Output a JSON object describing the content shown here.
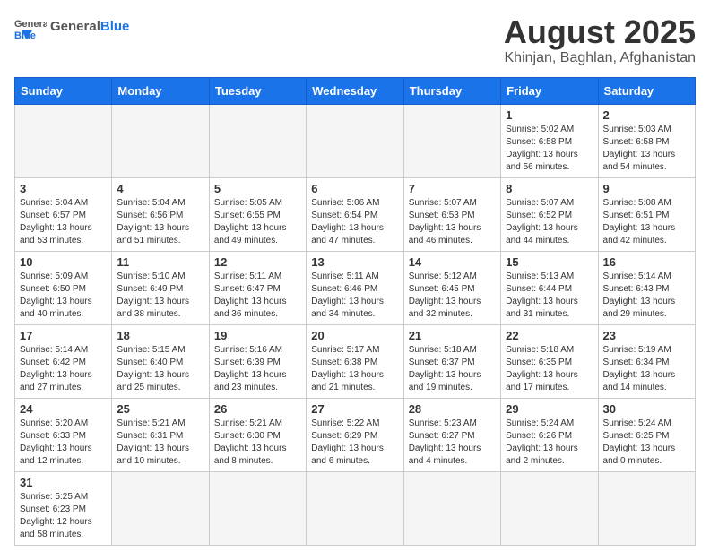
{
  "header": {
    "logo_general": "General",
    "logo_blue": "Blue",
    "title": "August 2025",
    "subtitle": "Khinjan, Baghlan, Afghanistan"
  },
  "weekdays": [
    "Sunday",
    "Monday",
    "Tuesday",
    "Wednesday",
    "Thursday",
    "Friday",
    "Saturday"
  ],
  "weeks": [
    [
      {
        "day": "",
        "info": ""
      },
      {
        "day": "",
        "info": ""
      },
      {
        "day": "",
        "info": ""
      },
      {
        "day": "",
        "info": ""
      },
      {
        "day": "",
        "info": ""
      },
      {
        "day": "1",
        "info": "Sunrise: 5:02 AM\nSunset: 6:58 PM\nDaylight: 13 hours and 56 minutes."
      },
      {
        "day": "2",
        "info": "Sunrise: 5:03 AM\nSunset: 6:58 PM\nDaylight: 13 hours and 54 minutes."
      }
    ],
    [
      {
        "day": "3",
        "info": "Sunrise: 5:04 AM\nSunset: 6:57 PM\nDaylight: 13 hours and 53 minutes."
      },
      {
        "day": "4",
        "info": "Sunrise: 5:04 AM\nSunset: 6:56 PM\nDaylight: 13 hours and 51 minutes."
      },
      {
        "day": "5",
        "info": "Sunrise: 5:05 AM\nSunset: 6:55 PM\nDaylight: 13 hours and 49 minutes."
      },
      {
        "day": "6",
        "info": "Sunrise: 5:06 AM\nSunset: 6:54 PM\nDaylight: 13 hours and 47 minutes."
      },
      {
        "day": "7",
        "info": "Sunrise: 5:07 AM\nSunset: 6:53 PM\nDaylight: 13 hours and 46 minutes."
      },
      {
        "day": "8",
        "info": "Sunrise: 5:07 AM\nSunset: 6:52 PM\nDaylight: 13 hours and 44 minutes."
      },
      {
        "day": "9",
        "info": "Sunrise: 5:08 AM\nSunset: 6:51 PM\nDaylight: 13 hours and 42 minutes."
      }
    ],
    [
      {
        "day": "10",
        "info": "Sunrise: 5:09 AM\nSunset: 6:50 PM\nDaylight: 13 hours and 40 minutes."
      },
      {
        "day": "11",
        "info": "Sunrise: 5:10 AM\nSunset: 6:49 PM\nDaylight: 13 hours and 38 minutes."
      },
      {
        "day": "12",
        "info": "Sunrise: 5:11 AM\nSunset: 6:47 PM\nDaylight: 13 hours and 36 minutes."
      },
      {
        "day": "13",
        "info": "Sunrise: 5:11 AM\nSunset: 6:46 PM\nDaylight: 13 hours and 34 minutes."
      },
      {
        "day": "14",
        "info": "Sunrise: 5:12 AM\nSunset: 6:45 PM\nDaylight: 13 hours and 32 minutes."
      },
      {
        "day": "15",
        "info": "Sunrise: 5:13 AM\nSunset: 6:44 PM\nDaylight: 13 hours and 31 minutes."
      },
      {
        "day": "16",
        "info": "Sunrise: 5:14 AM\nSunset: 6:43 PM\nDaylight: 13 hours and 29 minutes."
      }
    ],
    [
      {
        "day": "17",
        "info": "Sunrise: 5:14 AM\nSunset: 6:42 PM\nDaylight: 13 hours and 27 minutes."
      },
      {
        "day": "18",
        "info": "Sunrise: 5:15 AM\nSunset: 6:40 PM\nDaylight: 13 hours and 25 minutes."
      },
      {
        "day": "19",
        "info": "Sunrise: 5:16 AM\nSunset: 6:39 PM\nDaylight: 13 hours and 23 minutes."
      },
      {
        "day": "20",
        "info": "Sunrise: 5:17 AM\nSunset: 6:38 PM\nDaylight: 13 hours and 21 minutes."
      },
      {
        "day": "21",
        "info": "Sunrise: 5:18 AM\nSunset: 6:37 PM\nDaylight: 13 hours and 19 minutes."
      },
      {
        "day": "22",
        "info": "Sunrise: 5:18 AM\nSunset: 6:35 PM\nDaylight: 13 hours and 17 minutes."
      },
      {
        "day": "23",
        "info": "Sunrise: 5:19 AM\nSunset: 6:34 PM\nDaylight: 13 hours and 14 minutes."
      }
    ],
    [
      {
        "day": "24",
        "info": "Sunrise: 5:20 AM\nSunset: 6:33 PM\nDaylight: 13 hours and 12 minutes."
      },
      {
        "day": "25",
        "info": "Sunrise: 5:21 AM\nSunset: 6:31 PM\nDaylight: 13 hours and 10 minutes."
      },
      {
        "day": "26",
        "info": "Sunrise: 5:21 AM\nSunset: 6:30 PM\nDaylight: 13 hours and 8 minutes."
      },
      {
        "day": "27",
        "info": "Sunrise: 5:22 AM\nSunset: 6:29 PM\nDaylight: 13 hours and 6 minutes."
      },
      {
        "day": "28",
        "info": "Sunrise: 5:23 AM\nSunset: 6:27 PM\nDaylight: 13 hours and 4 minutes."
      },
      {
        "day": "29",
        "info": "Sunrise: 5:24 AM\nSunset: 6:26 PM\nDaylight: 13 hours and 2 minutes."
      },
      {
        "day": "30",
        "info": "Sunrise: 5:24 AM\nSunset: 6:25 PM\nDaylight: 13 hours and 0 minutes."
      }
    ],
    [
      {
        "day": "31",
        "info": "Sunrise: 5:25 AM\nSunset: 6:23 PM\nDaylight: 12 hours and 58 minutes."
      },
      {
        "day": "",
        "info": ""
      },
      {
        "day": "",
        "info": ""
      },
      {
        "day": "",
        "info": ""
      },
      {
        "day": "",
        "info": ""
      },
      {
        "day": "",
        "info": ""
      },
      {
        "day": "",
        "info": ""
      }
    ]
  ]
}
